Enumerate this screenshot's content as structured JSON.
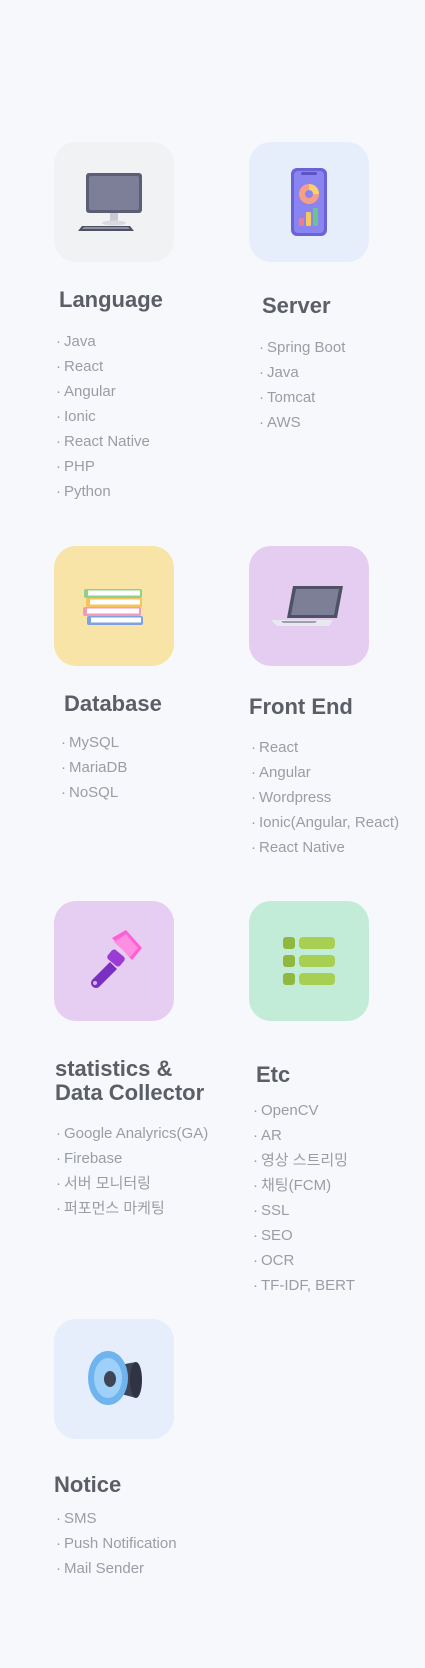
{
  "colors": {
    "page_bg": "#f7f8fb",
    "title": "#5b5e66",
    "item": "#9a9da6",
    "tile_language": "#f1f2f4",
    "tile_server": "#e6eefc",
    "tile_database": "#f8e4a6",
    "tile_frontend": "#e5cdf2",
    "tile_statistics": "#e6cdf2",
    "tile_etc": "#c3ecd8",
    "tile_notice": "#e6eefb"
  },
  "sections": {
    "language": {
      "title": "Language",
      "icon": "desktop-monitor-icon",
      "items": [
        "Java",
        "React",
        "Angular",
        "Ionic",
        "React Native",
        "PHP",
        "Python"
      ]
    },
    "server": {
      "title": "Server",
      "icon": "phone-chart-icon",
      "items": [
        "Spring Boot",
        "Java",
        "Tomcat",
        "AWS"
      ]
    },
    "database": {
      "title": "Database",
      "icon": "book-stack-icon",
      "items": [
        "MySQL",
        "MariaDB",
        "NoSQL"
      ]
    },
    "frontend": {
      "title": "Front End",
      "icon": "laptop-icon",
      "items": [
        "React",
        "Angular",
        "Wordpress",
        "Ionic(Angular, React)",
        "React Native"
      ]
    },
    "statistics": {
      "title_line1": "statistics &",
      "title_line2": "Data Collector",
      "icon": "paint-brush-icon",
      "items": [
        "Google Analyrics(GA)",
        "Firebase",
        "서버 모니터링",
        "퍼포먼스 마케팅"
      ]
    },
    "etc": {
      "title": "Etc",
      "icon": "list-bars-icon",
      "items": [
        "OpenCV",
        "AR",
        "영상 스트리밍",
        "채팅(FCM)",
        "SSL",
        "SEO",
        "OCR",
        "TF-IDF, BERT"
      ]
    },
    "notice": {
      "title": "Notice",
      "icon": "speaker-icon",
      "items": [
        "SMS",
        "Push Notification",
        "Mail Sender"
      ]
    }
  }
}
